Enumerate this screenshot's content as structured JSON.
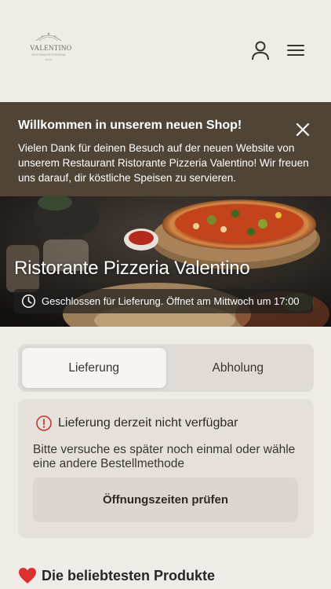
{
  "header": {
    "logo": {
      "name": "VALENTINO",
      "subtitle": "RISTORANTE PIZZERIA",
      "sub2": "SINCE"
    },
    "icons": [
      "user-icon",
      "menu-icon"
    ]
  },
  "welcome": {
    "title": "Willkommen in unserem neuen Shop!",
    "text": "Vielen Dank für deinen Besuch auf der neuen Website von unserem Restaurant Ristorante Pizzeria Valentino! Wir freuen uns darauf, dir köstliche Speisen zu servieren.",
    "close_icon": "close-icon",
    "background": "#504437"
  },
  "hero": {
    "title": "Ristorante Pizzeria Valentino",
    "status": "Geschlossen für Lieferung. Öffnet am Mittwoch um 17:00",
    "status_icon": "clock-icon"
  },
  "tabs": {
    "delivery": "Lieferung",
    "pickup": "Abholung",
    "active": "delivery"
  },
  "notice": {
    "title": "Lieferung derzeit nicht verfügbar",
    "text": "Bitte versuche es später noch einmal oder wähle eine andere Bestellmethode",
    "button": "Öffnungszeiten prüfen",
    "icon": "info-icon",
    "icon_color": "#c0392b"
  },
  "popular": {
    "title": "Die beliebtesten Produkte",
    "icon": "heart-icon",
    "icon_color": "#d93030"
  }
}
